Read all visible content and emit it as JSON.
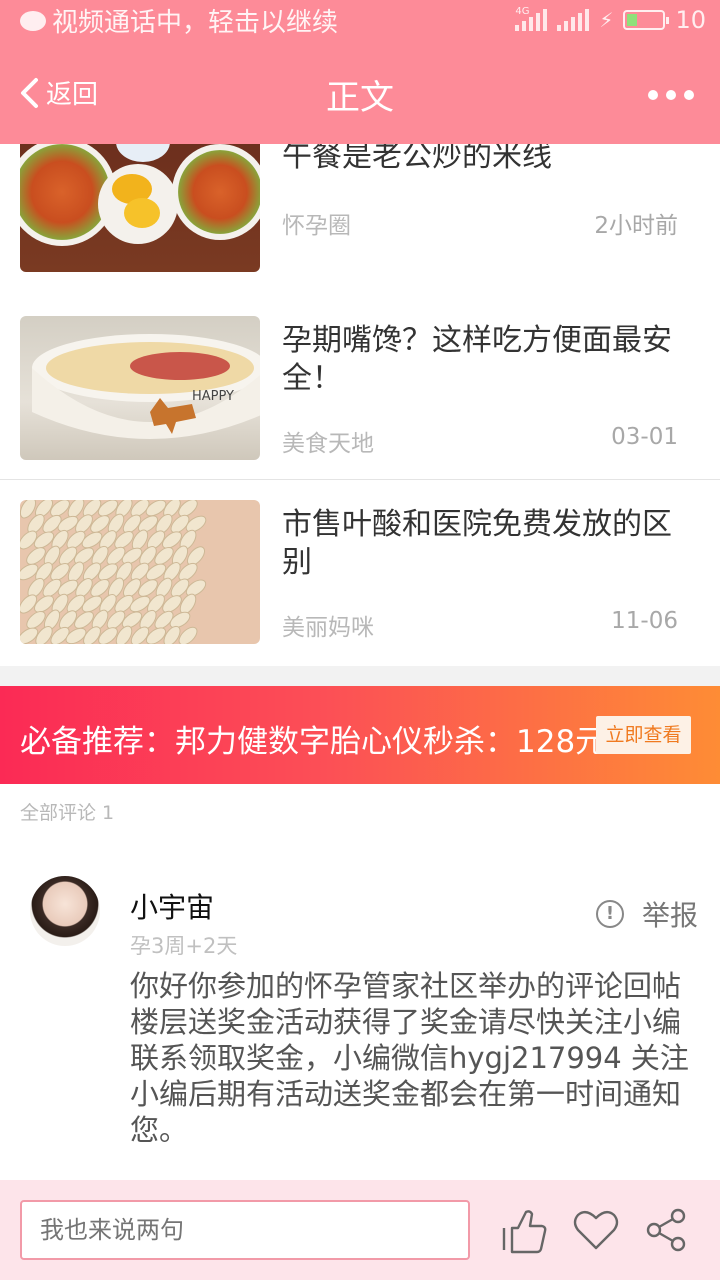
{
  "status_bar": {
    "call_text": "视频通话中，轻击以继续",
    "network_tag": "4G",
    "battery_text": "10"
  },
  "nav": {
    "back_label": "返回",
    "title": "正文"
  },
  "articles": [
    {
      "title": "午餐是老公炒的米线",
      "source": "怀孕圈",
      "time": "2小时前"
    },
    {
      "title": "孕期嘴馋？这样吃方便面最安全！",
      "source": "美食天地",
      "time": "03-01"
    },
    {
      "title": "市售叶酸和医院免费发放的区别",
      "source": "美丽妈咪",
      "time": "11-06"
    }
  ],
  "promo": {
    "text": "必备推荐：邦力健数字胎心仪秒杀：128元",
    "button": "立即查看"
  },
  "comments": {
    "count_label": "全部评论 1",
    "items": [
      {
        "user": "小宇宙",
        "tag": "孕3周+2天",
        "report_label": "举报",
        "body": "你好你参加的怀孕管家社区举办的评论回帖楼层送奖金活动获得了奖金请尽快关注小编联系领取奖金，小编微信hygj217994 关注小编后期有活动送奖金都会在第一时间通知您。"
      }
    ]
  },
  "bottom_bar": {
    "input_placeholder": "我也来说两句",
    "icons": [
      "thumbs-up-icon",
      "heart-icon",
      "share-icon"
    ]
  },
  "colors": {
    "header": "#fd8b98",
    "promo_start": "#fb2a55",
    "promo_end": "#fe8c35",
    "bottom_bar": "#fde4ea",
    "input_border": "#f29aa8"
  }
}
